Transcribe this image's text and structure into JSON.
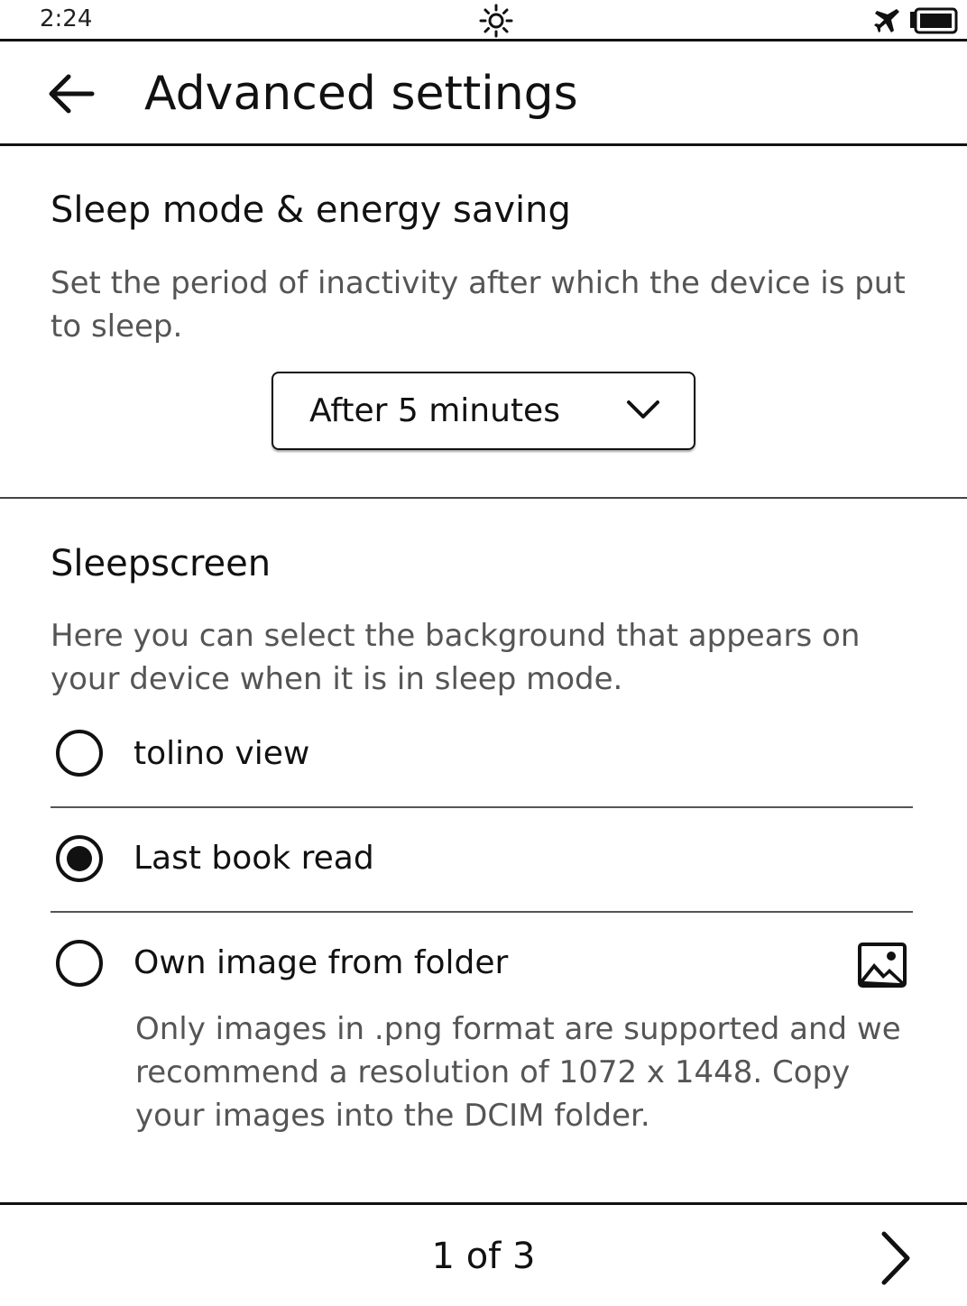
{
  "status_bar": {
    "time": "2:24",
    "icons": [
      "brightness-icon",
      "airplane-mode-icon",
      "battery-icon"
    ]
  },
  "header": {
    "title": "Advanced settings",
    "back_icon": "back-arrow-icon"
  },
  "sleep_section": {
    "title": "Sleep mode & energy saving",
    "description": "Set the period of inactivity after which the device is put to sleep.",
    "dropdown": {
      "selected": "After 5 minutes",
      "icon": "chevron-down-icon"
    }
  },
  "sleepscreen_section": {
    "title": "Sleepscreen",
    "description": "Here you can select the background that appears on your device when it is in sleep mode.",
    "options": [
      {
        "label": "tolino view",
        "selected": false
      },
      {
        "label": "Last book read",
        "selected": true
      },
      {
        "label": "Own image from folder",
        "selected": false,
        "icon": "image-icon"
      }
    ],
    "own_image_note": "Only images in .png format are supported and we recommend a resolution of 1072 x 1448. Copy your images into the DCIM folder."
  },
  "footer": {
    "page_indicator": "1 of 3",
    "next_icon": "chevron-right-icon"
  }
}
